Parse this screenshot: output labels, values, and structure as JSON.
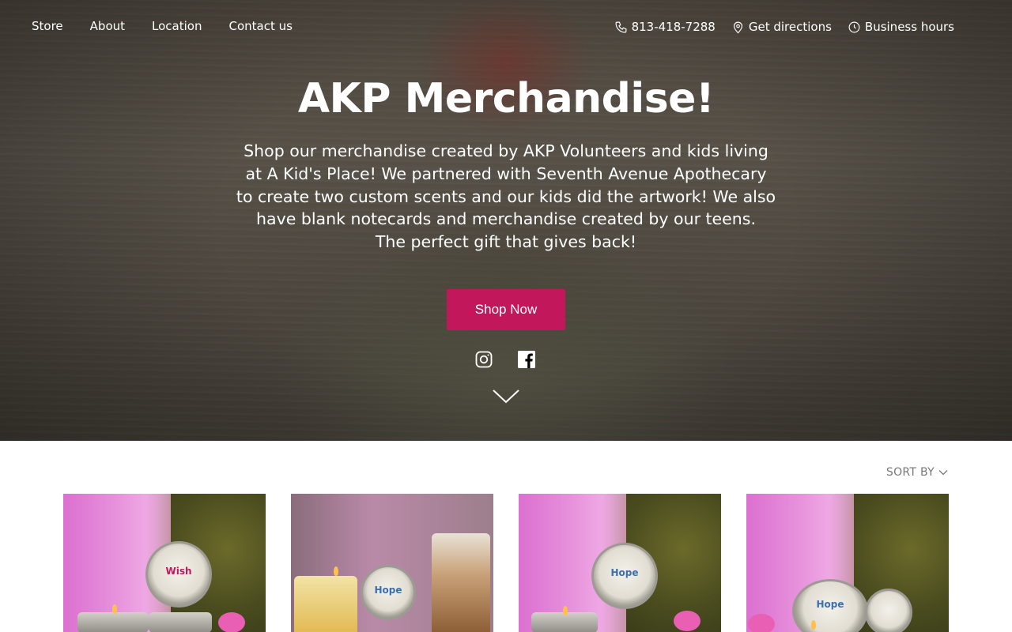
{
  "nav": {
    "items": [
      "Store",
      "About",
      "Location",
      "Contact us"
    ]
  },
  "contact": {
    "phone": "813-418-7288",
    "directions": "Get directions",
    "hours": "Business hours"
  },
  "hero": {
    "title": "AKP Merchandise!",
    "description_lines": [
      "Shop our merchandise created by AKP Volunteers and kids living",
      "at A Kid's Place!  We partnered with Seventh Avenue Apothecary",
      "to create two custom scents and our kids did the artwork!  We also",
      "have blank notecards and merchandise created by our teens.",
      "The perfect gift that gives back!"
    ],
    "cta": "Shop Now"
  },
  "social": {
    "icons": [
      "instagram-icon",
      "facebook-icon"
    ]
  },
  "products": {
    "sort_label": "SORT BY",
    "items": [
      {
        "tin_text": "Wish"
      },
      {
        "tin_text": "Hope"
      },
      {
        "tin_text": "Hope"
      },
      {
        "tin_text": "Hope"
      }
    ]
  },
  "colors": {
    "accent": "#c2185b",
    "sort_text": "#777777"
  }
}
